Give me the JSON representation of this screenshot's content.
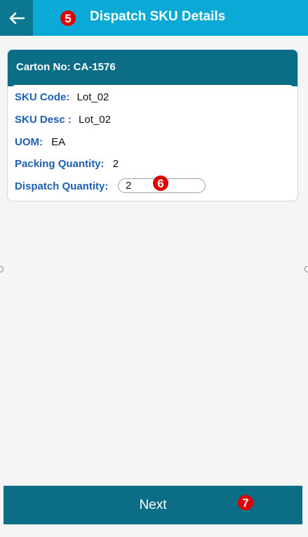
{
  "header": {
    "title": "Dispatch SKU Details",
    "back_icon": "arrow-left-icon",
    "marker": "5"
  },
  "carton": {
    "label": "Carton No:",
    "value": "CA-1576"
  },
  "details": {
    "sku_code_label": "SKU Code:",
    "sku_code_value": "Lot_02",
    "sku_desc_label": "SKU Desc :",
    "sku_desc_value": "Lot_02",
    "uom_label": "UOM:",
    "uom_value": "EA",
    "packing_qty_label": "Packing Quantity:",
    "packing_qty_value": "2",
    "dispatch_qty_label": "Dispatch Quantity:",
    "dispatch_qty_value": "2",
    "marker": "6"
  },
  "footer": {
    "next_label": "Next",
    "marker": "7"
  },
  "colors": {
    "appbar": "#0aa9d6",
    "primary_dark": "#0b6e86",
    "label_blue": "#1f5fb2",
    "marker_red": "#e10000"
  }
}
